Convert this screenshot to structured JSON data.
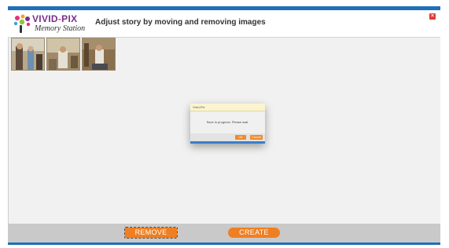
{
  "header": {
    "logo_brand_part1": "VIVID",
    "logo_brand_dash": "-",
    "logo_brand_part2": "PIX",
    "logo_subtitle": "Memory Station",
    "title": "Adjust story by moving and removing images",
    "close_glyph": "×"
  },
  "thumbnails": [
    {
      "name": "photo-1",
      "tone": "#7a6a58"
    },
    {
      "name": "photo-2",
      "tone": "#8b7b5d"
    },
    {
      "name": "photo-3",
      "tone": "#6d5c44"
    }
  ],
  "dialog": {
    "title": "Vivid-Pix",
    "message": "Save in progress. Please wait.",
    "ok_label": "Ok",
    "cancel_label": "Cancel"
  },
  "footer": {
    "remove_label": "REMOVE",
    "create_label": "CREATE"
  },
  "colors": {
    "accent": "#ef7f22",
    "brand_blue": "#1f6fb8",
    "close_red": "#e03b3b",
    "footer_bg": "#c9c9c9",
    "workspace_bg": "#f1f1f1"
  }
}
